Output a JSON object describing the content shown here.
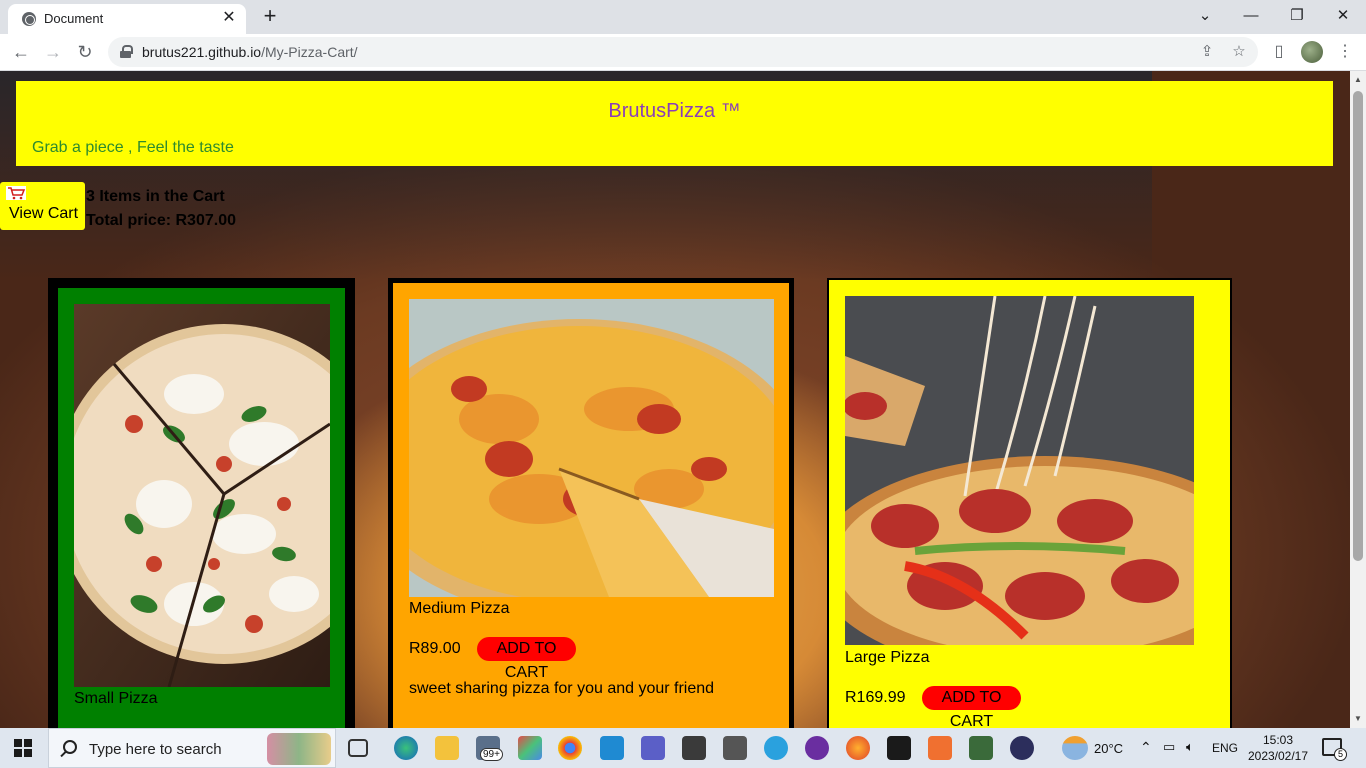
{
  "browser": {
    "tab_title": "Document",
    "url_host": "brutus221.github.io",
    "url_path": "/My-Pizza-Cart/"
  },
  "page": {
    "brand": "BrutusPizza ™",
    "tagline": "Grab a piece , Feel the taste",
    "cart_button": "View Cart",
    "cart_count_text": "3 Items in the Cart",
    "cart_total_text": "Total price: R307.00",
    "products": [
      {
        "name": "Small Pizza",
        "price": "",
        "button": "",
        "description": ""
      },
      {
        "name": "Medium Pizza",
        "price": "R89.00",
        "button": "ADD TO CART",
        "description": "sweet sharing pizza for you and your friend"
      },
      {
        "name": "Large Pizza",
        "price": "R169.99",
        "button": "ADD TO CART",
        "description": ""
      }
    ]
  },
  "taskbar": {
    "search_placeholder": "Type here to search",
    "mail_badge": "99+",
    "weather": "20°C",
    "language": "ENG",
    "time": "15:03",
    "date": "2023/02/17",
    "notification_count": "5"
  },
  "colors": {
    "header_bg": "#ffff00",
    "brand_text": "#8b3fb8",
    "tagline_text": "#2e8b2e",
    "small_card": "#008000",
    "medium_card": "#ffa500",
    "large_card": "#ffff00",
    "add_button": "#ff0000"
  }
}
